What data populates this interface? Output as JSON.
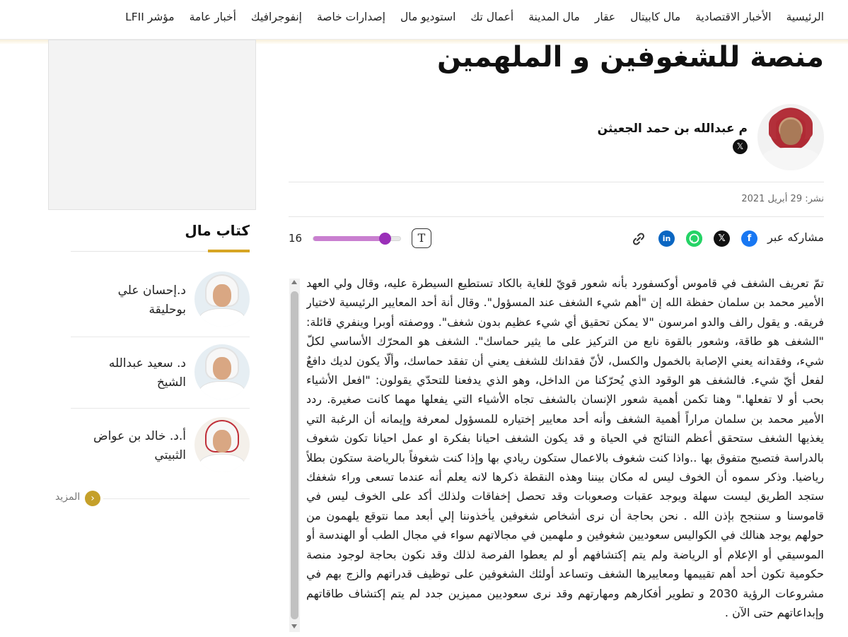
{
  "nav": {
    "items": [
      "الرئيسية",
      "الأخبار الاقتصادية",
      "مال كابيتال",
      "عقار",
      "مال المدينة",
      "أعمال تك",
      "استوديو مال",
      "إصدارات خاصة",
      "إنفوجرافيك",
      "أخبار عامة",
      "مؤشر LFII"
    ]
  },
  "article": {
    "title": "منصة للشغوفين و الملهمين",
    "author": "م عبدالله بن حمد الجعيثن",
    "author_x_icon": "x-icon",
    "published": "نشر: 29 أبريل 2021",
    "share_label": "مشاركه عبر",
    "share_icons": [
      "facebook-icon",
      "x-icon",
      "whatsapp-icon",
      "linkedin-icon",
      "link-icon"
    ],
    "font_button_label": "T",
    "font_size_value": "16",
    "font_size_fraction": 0.78,
    "body": "تمّ تعريف الشغف في قاموس أوكسفورد بأنه شعور قويّ للغاية بالكاد تستطيع السيطرة عليه، وقال ولي العهد الأمير محمد بن سلمان حفظة الله إن \"أهم شيء الشغف عند المسؤول\". وقال أنة أحد المعايير الرئيسية لاختيار فريقه. و يقول رالف والدو امرسون \"لا يمكن تحقيق أي شيء عظيم بدون شغف\". ووصفته أوبرا وينفري قائلة: \"الشغف هو طاقة، وشعور بالقوة نابع من التركيز على ما يثير حماسك\". الشغف هو المحرّك الأساسي لكلّ شيء، وفقدانه يعني الإصابة بالخمول والكسل، لأنّ فقدانك للشغف يعني أن تفقد حماسك، وألّا يكون لديك دافعٌ لفعل أيّ شيء. فالشغف هو الوقود الذي يُحرّكنا من الداخل، وهو الذي يدفعنا للتحدّي يقولون: \"افعل الأشياء بحب أو لا تفعلها.\" وهنا تكمن أهمية شعور الإنسان بالشغف تجاه الأشياء التي يفعلها مهما كانت صغيرة. ردد الأمير محمد بن سلمان مراراً أهمية الشغف وأنه أحد معايير إختياره للمسؤول لمعرفة وإيمانه أن الرغبة التي يغذيها الشغف ستحقق أعظم النتائج في الحياة و قد يكون الشغف احيانا بفكرة او عمل احيانا تكون شغوف بالدراسة فتصبح متفوق بها ..واذا كنت شغوف بالاعمال ستكون ريادي بها وإذا كنت شغوفاً بالرياضة ستكون بطلاً رياضيا. وذكر سموه أن الخوف ليس له مكان بيننا وهذه النقطة ذكرها لانه يعلم أنه عندما تسعى وراء شغفك ستجد الطريق ليست سهلة ويوجد عقبات وصعوبات وقد تحصل إخفاقات ولذلك أكد على الخوف ليس في قاموسنا و سننجح بإذن الله . نحن بحاجة أن نرى أشخاص شغوفين يأخذوننا إلي أبعد مما نتوقع يلهمون من حولهم يوجد هنالك في الكواليس سعوديين شغوفين و ملهمين في مجالاتهم سواء في مجال الطب أو الهندسة أو الموسيقي أو الإعلام أو الرياضة ولم يتم إكتشافهم أو لم يعطوا الفرصة لذلك وقد نكون بحاجة لوجود منصة حكومية تكون أحد أهم تقييمها ومعاييرها الشغف وتساعد أولئك الشغوفين على توظيف قدراتهم والزج بهم في مشروعات الرؤية 2030 و تطوير أفكارهم ومهارتهم وقد نرى سعوديين مميزين جدد لم يتم إكتشاف طاقاتهم وإبداعاتهم حتى الآن ."
  },
  "sidebar": {
    "title": "كتاب مال",
    "writers": [
      {
        "name": "د.إحسان علي بوحليقة"
      },
      {
        "name": "د. سعيد عبدالله الشيخ"
      },
      {
        "name": "أ.د. خالد بن عواض الثبيتي"
      }
    ],
    "more_label": "المزيد",
    "more_icon": "chevron-left-icon"
  },
  "colors": {
    "accent_gold": "#d7a524",
    "slider_purple": "#9a2fb8",
    "facebook": "#1877f2",
    "whatsapp": "#25d366",
    "linkedin": "#0a66c2"
  }
}
